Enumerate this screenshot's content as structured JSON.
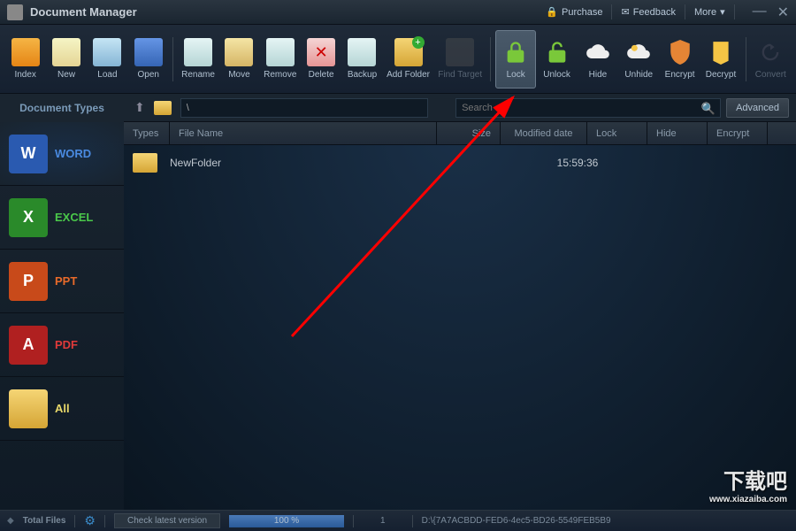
{
  "app": {
    "title": "Document Manager"
  },
  "topLinks": {
    "purchase": "Purchase",
    "feedback": "Feedback",
    "more": "More"
  },
  "toolbar": {
    "index": "Index",
    "new": "New",
    "load": "Load",
    "open": "Open",
    "rename": "Rename",
    "move": "Move",
    "remove": "Remove",
    "delete": "Delete",
    "backup": "Backup",
    "addFolder": "Add Folder",
    "findTarget": "Find Target",
    "lock": "Lock",
    "unlock": "Unlock",
    "hide": "Hide",
    "unhide": "Unhide",
    "encrypt": "Encrypt",
    "decrypt": "Decrypt",
    "convert": "Convert"
  },
  "pathbar": {
    "path": "\\",
    "searchPlaceholder": "Search",
    "advanced": "Advanced"
  },
  "sidebar": {
    "title": "Document Types",
    "items": [
      {
        "label": "WORD",
        "color": "#4a8ae0",
        "iconBg": "#2a5ab0",
        "text": "W"
      },
      {
        "label": "EXCEL",
        "color": "#4ac84a",
        "iconBg": "#2a8a2a",
        "text": "X"
      },
      {
        "label": "PPT",
        "color": "#e86a2a",
        "iconBg": "#c84a1a",
        "text": "P"
      },
      {
        "label": "PDF",
        "color": "#e03a3a",
        "iconBg": "#b02020",
        "text": "A"
      },
      {
        "label": "All",
        "color": "#e8d86a",
        "iconBg": "#d5a535",
        "text": ""
      }
    ]
  },
  "columns": {
    "types": "Types",
    "fileName": "File Name",
    "size": "Size",
    "modifiedDate": "Modified date",
    "lock": "Lock",
    "hide": "Hide",
    "encrypt": "Encrypt"
  },
  "rows": [
    {
      "name": "NewFolder",
      "date": "15:59:36"
    }
  ],
  "statusbar": {
    "totalFiles": "Total Files",
    "checkVersion": "Check latest version",
    "progress": "100 %",
    "count": "1",
    "path": "D:\\{7A7ACBDD-FED6-4ec5-BD26-5549FEB5B9"
  },
  "watermark": {
    "main": "下载吧",
    "sub": "www.xiazaiba.com"
  }
}
